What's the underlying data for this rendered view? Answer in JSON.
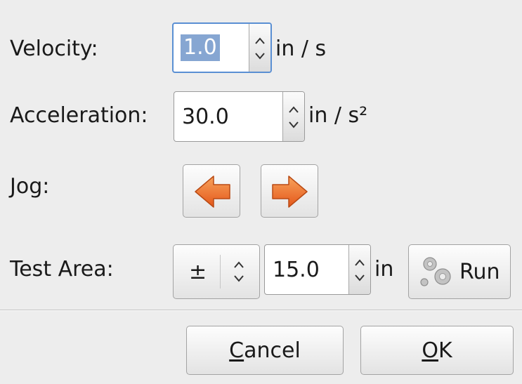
{
  "velocity": {
    "label": "Velocity:",
    "value": "1.0",
    "unit": "in / s"
  },
  "acceleration": {
    "label": "Acceleration:",
    "value": "30.0",
    "unit": "in / s²"
  },
  "jog": {
    "label": "Jog:"
  },
  "test_area": {
    "label": "Test Area:",
    "mode_value": "±",
    "value": "15.0",
    "unit": "in",
    "run_label": "Run"
  },
  "dialog": {
    "cancel_mnemonic": "C",
    "cancel_rest": "ancel",
    "ok_mnemonic": "O",
    "ok_rest": "K"
  },
  "colors": {
    "jog_arrow_top": "#f8a35c",
    "jog_arrow_bottom": "#e4571a",
    "selection": "#86a6d2",
    "focus_ring": "#5a8fd3"
  }
}
